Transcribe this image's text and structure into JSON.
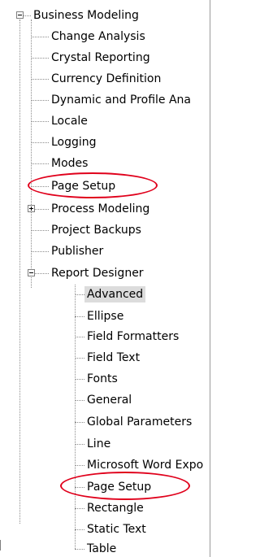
{
  "tree": {
    "root": {
      "label": "Business Modeling",
      "children": [
        {
          "label": "Change Analysis"
        },
        {
          "label": "Crystal Reporting"
        },
        {
          "label": "Currency Definition"
        },
        {
          "label": "Dynamic and Profile Ana"
        },
        {
          "label": "Locale"
        },
        {
          "label": "Logging"
        },
        {
          "label": "Modes"
        },
        {
          "label": "Page Setup"
        },
        {
          "label": "Process Modeling"
        },
        {
          "label": "Project Backups"
        },
        {
          "label": "Publisher"
        },
        {
          "label": "Report Designer",
          "children": [
            {
              "label": "Advanced"
            },
            {
              "label": "Ellipse"
            },
            {
              "label": "Field Formatters"
            },
            {
              "label": "Field Text"
            },
            {
              "label": "Fonts"
            },
            {
              "label": "General"
            },
            {
              "label": "Global Parameters"
            },
            {
              "label": "Line"
            },
            {
              "label": "Microsoft Word Expo"
            },
            {
              "label": "Page Setup"
            },
            {
              "label": "Rectangle"
            },
            {
              "label": "Static Text"
            },
            {
              "label": "Table"
            }
          ]
        }
      ]
    }
  },
  "colors": {
    "highlight_ellipse": "#e0001b",
    "selection_bg": "#dcdcdc"
  },
  "selected_item": "Advanced",
  "annotations": [
    "Page Setup",
    "Page Setup"
  ]
}
